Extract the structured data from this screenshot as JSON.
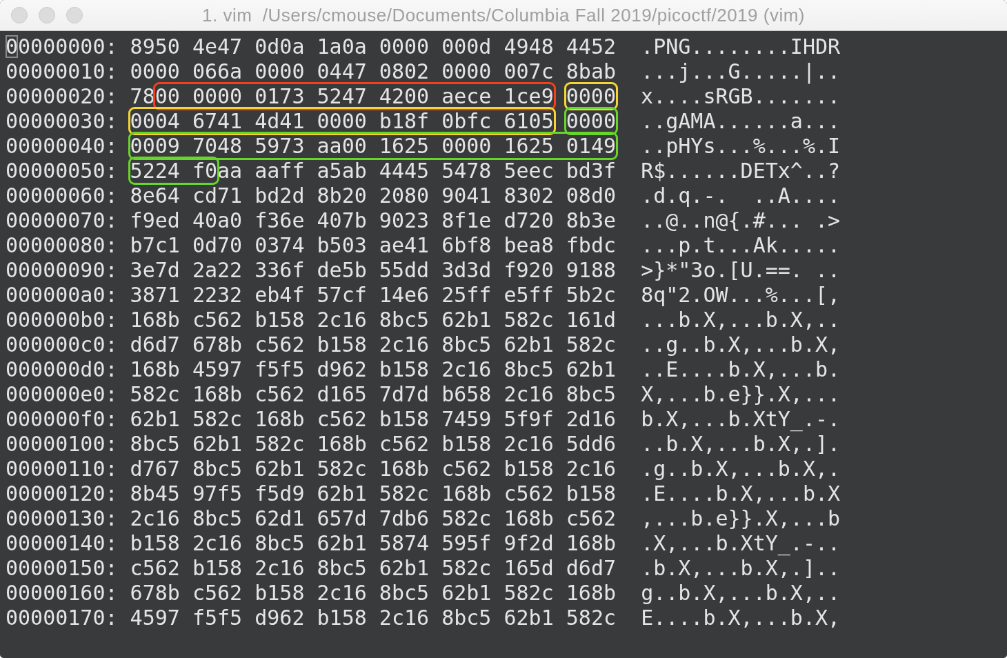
{
  "window": {
    "title": "1. vim  /Users/cmouse/Documents/Columbia Fall 2019/picoctf/2019 (vim)"
  },
  "rows": [
    {
      "offset": "00000000:",
      "cursor": true,
      "hex": [
        {
          "kind": "plain",
          "text": "8950 4e47 0d0a 1a0a 0000 000d 4948 4452"
        }
      ],
      "ascii": ".PNG........IHDR"
    },
    {
      "offset": "00000010:",
      "cursor": false,
      "hex": [
        {
          "kind": "plain",
          "text": "0000 066a 0000 0447 0802 0000 007c 8bab"
        }
      ],
      "ascii": "...j...G.....|.."
    },
    {
      "offset": "00000020:",
      "cursor": false,
      "hex": [
        {
          "kind": "plain",
          "text": "78"
        },
        {
          "kind": "boxed",
          "color": "#f5401f",
          "text": "00 0000 0173 5247 4200 aece 1ce9"
        },
        {
          "kind": "boxed",
          "color": "#f7d531",
          "text": "0000"
        }
      ],
      "ascii": "x....sRGB......."
    },
    {
      "offset": "00000030:",
      "cursor": false,
      "hex": [
        {
          "kind": "boxed",
          "color": "#f7d531",
          "text": "0004 6741 4d41 0000 b18f 0bfc 6105"
        },
        {
          "kind": "boxed",
          "color": "#66d62a",
          "text": "0000"
        }
      ],
      "ascii": "..gAMA......a..."
    },
    {
      "offset": "00000040:",
      "cursor": false,
      "hex": [
        {
          "kind": "boxed",
          "color": "#66d62a",
          "text": "0009 7048 5973 aa00 1625 0000 1625 0149"
        }
      ],
      "ascii": "..pHYs...%...%.I"
    },
    {
      "offset": "00000050:",
      "cursor": false,
      "hex": [
        {
          "kind": "boxed",
          "color": "#66d62a",
          "text": "5224 f0"
        },
        {
          "kind": "plain",
          "text": "aa aaff a5ab 4445 5478 5eec bd3f"
        }
      ],
      "ascii": "R$......DETx^..?"
    },
    {
      "offset": "00000060:",
      "cursor": false,
      "hex": [
        {
          "kind": "plain",
          "text": "8e64 cd71 bd2d 8b20 2080 9041 8302 08d0"
        }
      ],
      "ascii": ".d.q.-.  ..A...."
    },
    {
      "offset": "00000070:",
      "cursor": false,
      "hex": [
        {
          "kind": "plain",
          "text": "f9ed 40a0 f36e 407b 9023 8f1e d720 8b3e"
        }
      ],
      "ascii": "..@..n@{.#... .>"
    },
    {
      "offset": "00000080:",
      "cursor": false,
      "hex": [
        {
          "kind": "plain",
          "text": "b7c1 0d70 0374 b503 ae41 6bf8 bea8 fbdc"
        }
      ],
      "ascii": "...p.t...Ak....."
    },
    {
      "offset": "00000090:",
      "cursor": false,
      "hex": [
        {
          "kind": "plain",
          "text": "3e7d 2a22 336f de5b 55dd 3d3d f920 9188"
        }
      ],
      "ascii": ">}*\"3o.[U.==. .."
    },
    {
      "offset": "000000a0:",
      "cursor": false,
      "hex": [
        {
          "kind": "plain",
          "text": "3871 2232 eb4f 57cf 14e6 25ff e5ff 5b2c"
        }
      ],
      "ascii": "8q\"2.OW...%...[,"
    },
    {
      "offset": "000000b0:",
      "cursor": false,
      "hex": [
        {
          "kind": "plain",
          "text": "168b c562 b158 2c16 8bc5 62b1 582c 161d"
        }
      ],
      "ascii": "...b.X,...b.X,.."
    },
    {
      "offset": "000000c0:",
      "cursor": false,
      "hex": [
        {
          "kind": "plain",
          "text": "d6d7 678b c562 b158 2c16 8bc5 62b1 582c"
        }
      ],
      "ascii": "..g..b.X,...b.X,"
    },
    {
      "offset": "000000d0:",
      "cursor": false,
      "hex": [
        {
          "kind": "plain",
          "text": "168b 4597 f5f5 d962 b158 2c16 8bc5 62b1"
        }
      ],
      "ascii": "..E....b.X,...b."
    },
    {
      "offset": "000000e0:",
      "cursor": false,
      "hex": [
        {
          "kind": "plain",
          "text": "582c 168b c562 d165 7d7d b658 2c16 8bc5"
        }
      ],
      "ascii": "X,...b.e}}.X,..."
    },
    {
      "offset": "000000f0:",
      "cursor": false,
      "hex": [
        {
          "kind": "plain",
          "text": "62b1 582c 168b c562 b158 7459 5f9f 2d16"
        }
      ],
      "ascii": "b.X,...b.XtY_.-."
    },
    {
      "offset": "00000100:",
      "cursor": false,
      "hex": [
        {
          "kind": "plain",
          "text": "8bc5 62b1 582c 168b c562 b158 2c16 5dd6"
        }
      ],
      "ascii": "..b.X,...b.X,.]."
    },
    {
      "offset": "00000110:",
      "cursor": false,
      "hex": [
        {
          "kind": "plain",
          "text": "d767 8bc5 62b1 582c 168b c562 b158 2c16"
        }
      ],
      "ascii": ".g..b.X,...b.X,."
    },
    {
      "offset": "00000120:",
      "cursor": false,
      "hex": [
        {
          "kind": "plain",
          "text": "8b45 97f5 f5d9 62b1 582c 168b c562 b158"
        }
      ],
      "ascii": ".E....b.X,...b.X"
    },
    {
      "offset": "00000130:",
      "cursor": false,
      "hex": [
        {
          "kind": "plain",
          "text": "2c16 8bc5 62d1 657d 7db6 582c 168b c562"
        }
      ],
      "ascii": ",...b.e}}.X,...b"
    },
    {
      "offset": "00000140:",
      "cursor": false,
      "hex": [
        {
          "kind": "plain",
          "text": "b158 2c16 8bc5 62b1 5874 595f 9f2d 168b"
        }
      ],
      "ascii": ".X,...b.XtY_.-.."
    },
    {
      "offset": "00000150:",
      "cursor": false,
      "hex": [
        {
          "kind": "plain",
          "text": "c562 b158 2c16 8bc5 62b1 582c 165d d6d7"
        }
      ],
      "ascii": ".b.X,...b.X,.].."
    },
    {
      "offset": "00000160:",
      "cursor": false,
      "hex": [
        {
          "kind": "plain",
          "text": "678b c562 b158 2c16 8bc5 62b1 582c 168b"
        }
      ],
      "ascii": "g..b.X,...b.X,.."
    },
    {
      "offset": "00000170:",
      "cursor": false,
      "hex": [
        {
          "kind": "plain",
          "text": "4597 f5f5 d962 b158 2c16 8bc5 62b1 582c"
        }
      ],
      "ascii": "E....b.X,...b.X,"
    }
  ]
}
